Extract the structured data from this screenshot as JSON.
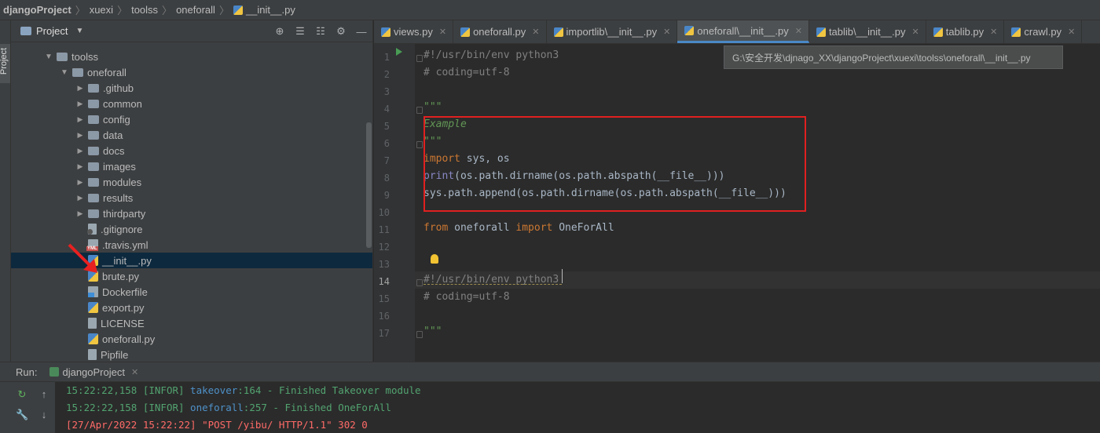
{
  "breadcrumb": [
    {
      "label": "djangoProject",
      "bold": true
    },
    {
      "label": "xuexi"
    },
    {
      "label": "toolss"
    },
    {
      "label": "oneforall"
    },
    {
      "label": "__init__.py",
      "icon": "python-file-icon"
    }
  ],
  "stripe": {
    "label": "Project"
  },
  "project_panel": {
    "title": "Project",
    "tools": [
      "locate-icon",
      "expand-all-icon",
      "collapse-all-icon",
      "gear-icon",
      "minimize-icon"
    ],
    "tools_glyphs": [
      "⊕",
      "☰",
      "☷",
      "⚙",
      "—"
    ],
    "tree": [
      {
        "label": "toolss",
        "type": "folder",
        "indent": 2,
        "expanded": true
      },
      {
        "label": "oneforall",
        "type": "folder",
        "indent": 3,
        "expanded": true
      },
      {
        "label": ".github",
        "type": "folder",
        "indent": 4,
        "expanded": false
      },
      {
        "label": "common",
        "type": "folder",
        "indent": 4,
        "expanded": false
      },
      {
        "label": "config",
        "type": "folder",
        "indent": 4,
        "expanded": false
      },
      {
        "label": "data",
        "type": "folder",
        "indent": 4,
        "expanded": false
      },
      {
        "label": "docs",
        "type": "folder",
        "indent": 4,
        "expanded": false
      },
      {
        "label": "images",
        "type": "folder",
        "indent": 4,
        "expanded": false
      },
      {
        "label": "modules",
        "type": "folder",
        "indent": 4,
        "expanded": false
      },
      {
        "label": "results",
        "type": "folder",
        "indent": 4,
        "expanded": false
      },
      {
        "label": "thirdparty",
        "type": "folder",
        "indent": 4,
        "expanded": false
      },
      {
        "label": ".gitignore",
        "type": "git",
        "indent": 4
      },
      {
        "label": ".travis.yml",
        "type": "yml",
        "indent": 4
      },
      {
        "label": "__init__.py",
        "type": "py",
        "indent": 4,
        "selected": true
      },
      {
        "label": "brute.py",
        "type": "py",
        "indent": 4
      },
      {
        "label": "Dockerfile",
        "type": "docker",
        "indent": 4
      },
      {
        "label": "export.py",
        "type": "py",
        "indent": 4
      },
      {
        "label": "LICENSE",
        "type": "file",
        "indent": 4
      },
      {
        "label": "oneforall.py",
        "type": "py",
        "indent": 4
      },
      {
        "label": "Pipfile",
        "type": "file",
        "indent": 4
      }
    ]
  },
  "editor_tabs": [
    {
      "label": "views.py",
      "active": false
    },
    {
      "label": "oneforall.py",
      "active": false
    },
    {
      "label": "importlib\\__init__.py",
      "active": false
    },
    {
      "label": "oneforall\\__init__.py",
      "active": true
    },
    {
      "label": "tablib\\__init__.py",
      "active": false
    },
    {
      "label": "tablib.py",
      "active": false
    },
    {
      "label": "crawl.py",
      "active": false
    }
  ],
  "tooltip": "G:\\安全开发\\djnago_XX\\djangoProject\\xuexi\\toolss\\oneforall\\__init__.py",
  "code_lines": [
    {
      "n": "1",
      "text": "#!/usr/bin/env python3",
      "cls": "cm"
    },
    {
      "n": "2",
      "text": "# coding=utf-8",
      "cls": "cm"
    },
    {
      "n": "3",
      "text": "",
      "cls": ""
    },
    {
      "n": "4",
      "text": "\"\"\"",
      "cls": "str"
    },
    {
      "n": "5",
      "text": "Example",
      "cls": "doc"
    },
    {
      "n": "6",
      "text": "\"\"\"",
      "cls": "str"
    },
    {
      "n": "7",
      "text": "import sys, os",
      "cls": "import"
    },
    {
      "n": "8",
      "text": "print(os.path.dirname(os.path.abspath(__file__)))",
      "cls": "print"
    },
    {
      "n": "9",
      "text": "sys.path.append(os.path.dirname(os.path.abspath(__file__)))",
      "cls": ""
    },
    {
      "n": "10",
      "text": "",
      "cls": ""
    },
    {
      "n": "11",
      "text": "from oneforall import OneForAll",
      "cls": "from"
    },
    {
      "n": "12",
      "text": "",
      "cls": ""
    },
    {
      "n": "13",
      "text": "",
      "cls": ""
    },
    {
      "n": "14",
      "text": "#!/usr/bin/env python3",
      "cls": "cm"
    },
    {
      "n": "15",
      "text": "# coding=utf-8",
      "cls": "cm"
    },
    {
      "n": "16",
      "text": "",
      "cls": ""
    },
    {
      "n": "17",
      "text": "\"\"\"",
      "cls": "str"
    }
  ],
  "current_line": "14",
  "run_panel": {
    "label": "Run:",
    "tab": "djangoProject",
    "lines": [
      {
        "time": "15:22:22,158",
        "level": "[INFOR]",
        "module": "takeover",
        "lineno": ":164",
        "msg": " - Finished Takeover module",
        "kind": "info"
      },
      {
        "time": "15:22:22,158",
        "level": "[INFOR]",
        "module": "oneforall",
        "lineno": ":257",
        "msg": " - Finished OneForAll",
        "kind": "info"
      },
      {
        "text": "[27/Apr/2022 15:22:22] \"POST /yibu/ HTTP/1.1\" 302 0",
        "kind": "err"
      }
    ]
  },
  "colors": {
    "accent": "#4a88c7",
    "selection": "#0d293e",
    "highlight_box": "#e02020"
  }
}
